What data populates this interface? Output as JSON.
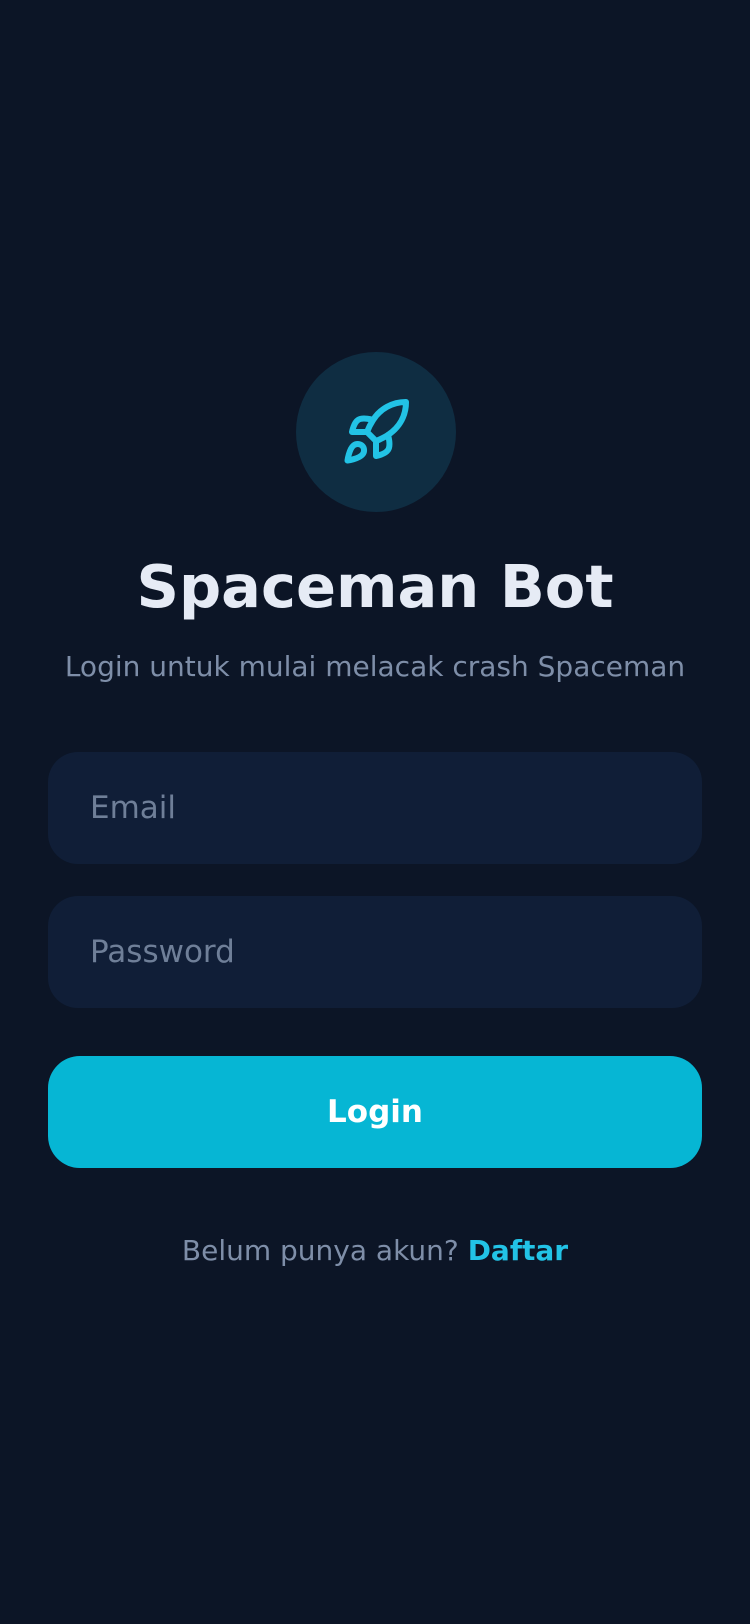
{
  "app": {
    "title": "Spaceman Bot",
    "subtitle": "Login untuk mulai melacak crash Spaceman",
    "logo_icon": "rocket-icon"
  },
  "form": {
    "email_placeholder": "Email",
    "email_value": "",
    "password_placeholder": "Password",
    "password_value": "",
    "login_label": "Login"
  },
  "signup": {
    "prompt": "Belum punya akun?",
    "link_label": "Daftar"
  },
  "colors": {
    "background": "#0c1526",
    "accent": "#06b6d4",
    "link": "#22c3e6",
    "field_bg": "#101e37",
    "logo_bg": "#0f2d42"
  }
}
